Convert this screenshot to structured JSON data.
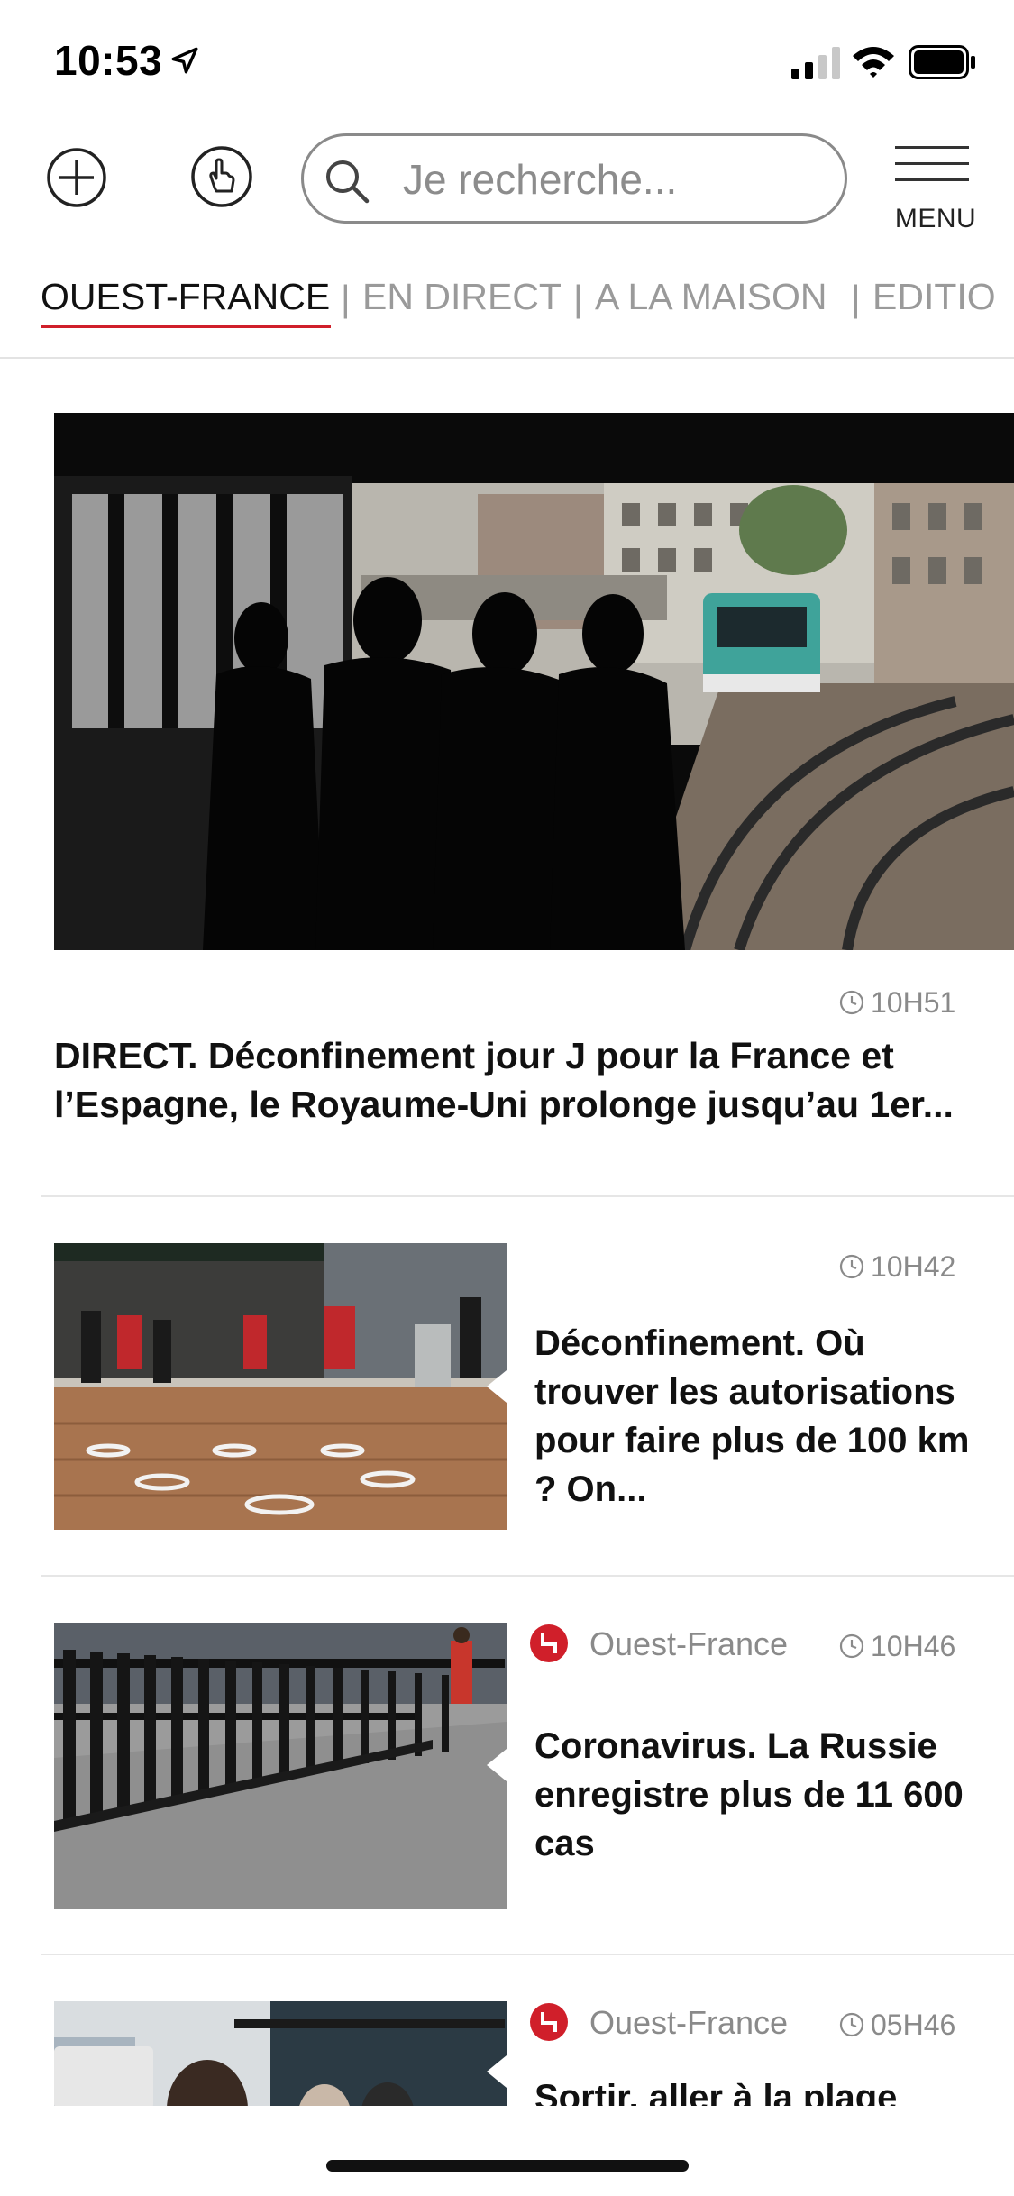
{
  "status_bar": {
    "time": "10:53"
  },
  "toolbar": {
    "search_placeholder": "Je recherche...",
    "menu_label": "MENU"
  },
  "tabs": [
    {
      "label": "OUEST-FRANCE",
      "active": true
    },
    {
      "label": "EN DIRECT",
      "active": false
    },
    {
      "label": "A LA MAISON",
      "active": false
    },
    {
      "label": "EDITIO",
      "active": false
    }
  ],
  "tab_separator": "|",
  "hero": {
    "time": "10H51",
    "title": "DIRECT. Déconfinement jour J pour la France et l’Espagne, le Royaume-Uni prolonge jusqu’au 1er..."
  },
  "articles": [
    {
      "time": "10H42",
      "source": "",
      "title": "Déconfinement. Où trouver les autorisations pour faire plus de 100 km ? On..."
    },
    {
      "time": "10H46",
      "source": "Ouest-France",
      "title": "Coronavirus. La Russie enregistre plus de 11 600 cas"
    },
    {
      "time": "05H46",
      "source": "Ouest-France",
      "title": "Sortir, aller à la plage"
    }
  ],
  "colors": {
    "accent": "#d01f2a",
    "muted": "#8a8a8a"
  }
}
